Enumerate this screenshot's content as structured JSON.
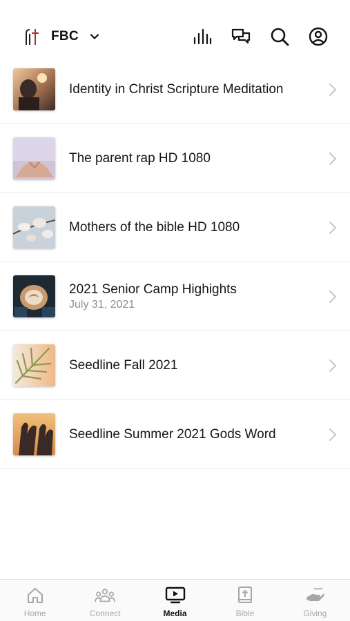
{
  "header": {
    "brand_name": "FBC",
    "icons": [
      "church-logo-icon",
      "chevron-down-icon",
      "audio-bars-icon",
      "chat-icon",
      "search-icon",
      "profile-icon"
    ]
  },
  "media": {
    "items": [
      {
        "title": "Identity in Christ Scripture Meditation",
        "subtitle": ""
      },
      {
        "title": "The parent rap HD 1080",
        "subtitle": ""
      },
      {
        "title": "Mothers of the bible HD 1080",
        "subtitle": ""
      },
      {
        "title": "2021 Senior Camp Highights",
        "subtitle": "July 31, 2021"
      },
      {
        "title": "Seedline Fall 2021",
        "subtitle": ""
      },
      {
        "title": "Seedline Summer 2021 Gods Word",
        "subtitle": ""
      }
    ]
  },
  "tabs": {
    "home": "Home",
    "connect": "Connect",
    "media": "Media",
    "bible": "Bible",
    "giving": "Giving",
    "active": "Media"
  },
  "colors": {
    "text": "#161616",
    "muted": "#8e8e8e",
    "tab_inactive": "#a6a6a6",
    "divider": "#e8e8e8"
  }
}
